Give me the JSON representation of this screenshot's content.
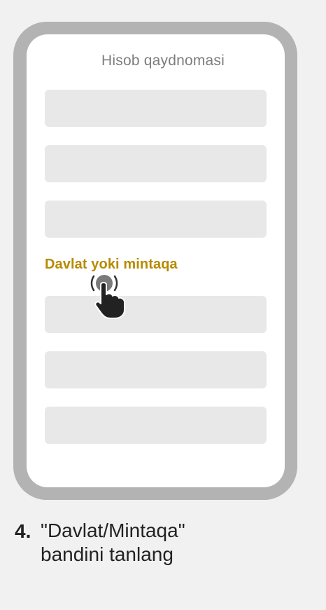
{
  "screen": {
    "title": "Hisob qaydnomasi",
    "highlight_label": "Davlat yoki mintaqa",
    "field_count_above": 3,
    "field_count_below": 3
  },
  "icons": {
    "tap": "tap-hand-icon"
  },
  "colors": {
    "background": "#f1f1f1",
    "frame": "#b3b3b3",
    "field": "#e8e8e8",
    "highlight": "#b88a00"
  },
  "step": {
    "number": "4.",
    "text_line1": "\"Davlat/Mintaqa\"",
    "text_line2": "bandini tanlang"
  }
}
